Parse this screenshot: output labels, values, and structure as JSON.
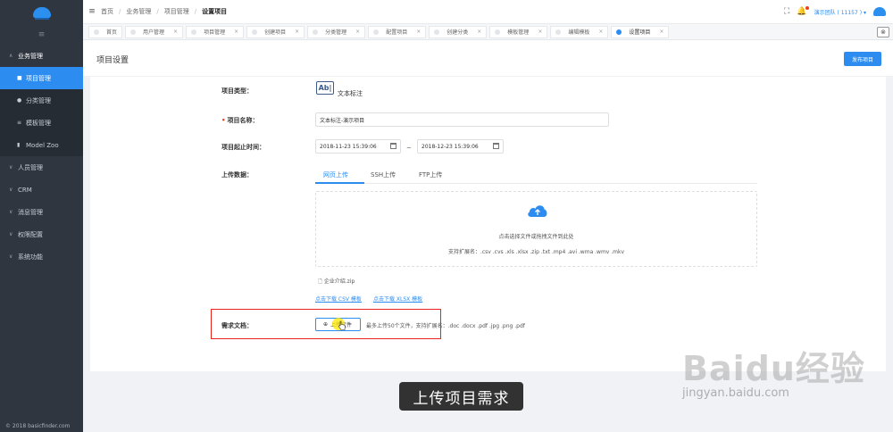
{
  "sidebar": {
    "groups": [
      {
        "label": "业务管理",
        "open": true,
        "items": [
          {
            "label": "项目管理",
            "active": true
          },
          {
            "label": "分类管理",
            "active": false
          },
          {
            "label": "模板管理",
            "active": false
          },
          {
            "label": "Model Zoo",
            "active": false
          }
        ]
      },
      {
        "label": "人员管理",
        "open": false
      },
      {
        "label": "CRM",
        "open": false
      },
      {
        "label": "消息管理",
        "open": false
      },
      {
        "label": "权限配置",
        "open": false
      },
      {
        "label": "系统功能",
        "open": false
      }
    ],
    "copyright": "© 2018 basicfinder.com"
  },
  "header": {
    "breadcrumb": [
      "首页",
      "业务管理",
      "项目管理",
      "设置项目"
    ],
    "user": "演示团队 ( 11157 ) ▾"
  },
  "tabs": [
    "首页",
    "用户管理",
    "项目管理",
    "创建项目",
    "分类管理",
    "配置项目",
    "创建分类",
    "模板管理",
    "编辑模板",
    "设置项目"
  ],
  "page": {
    "title": "项目设置",
    "publish_label": "发布项目"
  },
  "form": {
    "type_label": "项目类型：",
    "type_icon_text": "Ab|",
    "type_value": "文本标注",
    "name_label": "项目名称：",
    "name_value": "文本标注-演示项目",
    "time_label": "项目起止时间：",
    "start_time": "2018-11-23 15:39:06",
    "end_time": "2018-12-23 15:39:06",
    "time_sep": "~",
    "upload_label": "上传数据：",
    "upload_tabs": [
      "网页上传",
      "SSH上传",
      "FTP上传"
    ],
    "drop_text": "点击选择文件或拖拽文件到此处",
    "drop_ext": "支持扩展名：.csv .cvs .xls .xlsx .zip .txt  .mp4 .avi .wma .wmv .mkv",
    "file_name": "企业介绍.zip",
    "csv_link": "点击下载 CSV 模板",
    "xlsx_link": "点击下载 XLSX 模板",
    "req_doc_label": "需求文档：",
    "upload_btn": "上传文件",
    "upload_hint": "最多上传50个文件，支持扩展名：.doc .docx .pdf .jpg .png .pdf"
  },
  "overlay": {
    "caption": "上传项目需求",
    "watermark_brand": "Baidu经验",
    "watermark_url": "jingyan.baidu.com"
  },
  "colors": {
    "primary": "#2d8cf0",
    "sidebar": "#2f3640",
    "highlight_box": "#e8231c"
  }
}
